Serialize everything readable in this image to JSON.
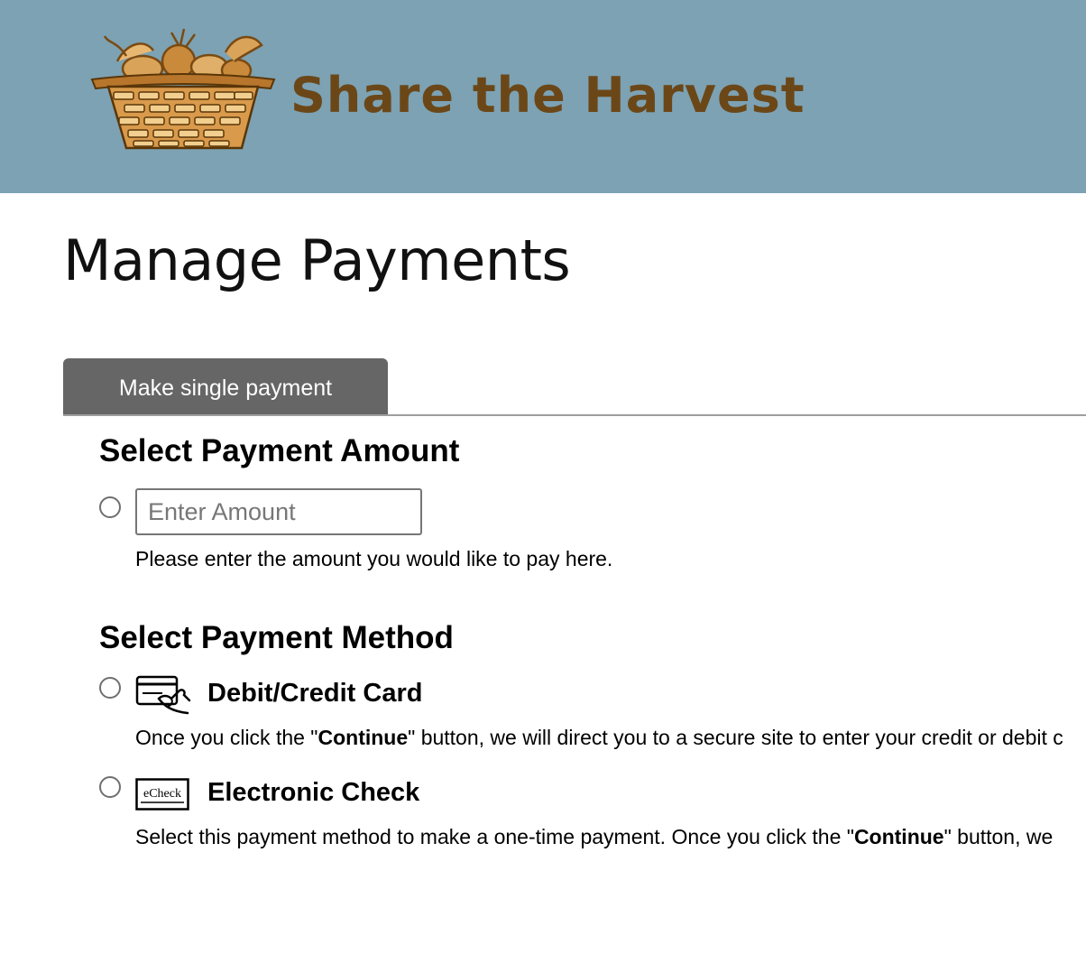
{
  "header": {
    "logo_text": "Share the Harvest",
    "logo_icon": "harvest-basket-icon",
    "background_color": "#7ca2b4",
    "logo_text_color": "#6b4718"
  },
  "page": {
    "title": "Manage Payments"
  },
  "tabs": [
    {
      "label": "Make single payment",
      "active": true
    }
  ],
  "amount_section": {
    "heading": "Select Payment Amount",
    "input_placeholder": "Enter Amount",
    "input_value": "",
    "helper_text": "Please enter the amount you would like to pay here."
  },
  "method_section": {
    "heading": "Select Payment Method",
    "methods": [
      {
        "label": "Debit/Credit Card",
        "icon": "credit-card-hand-icon",
        "desc_before": "Once you click the \"",
        "desc_bold": "Continue",
        "desc_after": "\" button, we will direct you to a secure site to enter your credit or debit c"
      },
      {
        "label": "Electronic Check",
        "icon": "echeck-icon",
        "icon_text": "eCheck",
        "desc_before": "Select this payment method to make a one-time payment. Once you click the \"",
        "desc_bold": "Continue",
        "desc_after": "\" button, we"
      }
    ]
  },
  "colors": {
    "tab_active_bg": "#666666",
    "tab_active_text": "#ffffff",
    "divider": "#9e9e9e"
  }
}
